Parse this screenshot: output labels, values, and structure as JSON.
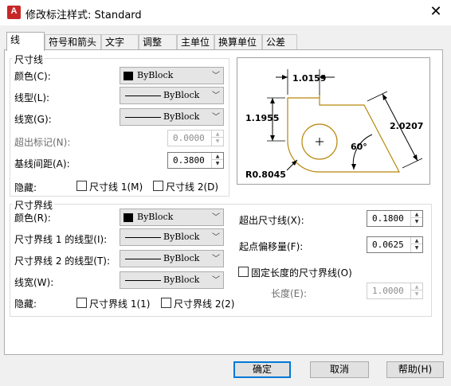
{
  "window": {
    "title": "修改标注样式: Standard",
    "icon_text": "A",
    "close_glyph": "✕"
  },
  "tabs": [
    {
      "label": "线"
    },
    {
      "label": "符号和箭头"
    },
    {
      "label": "文字"
    },
    {
      "label": "调整"
    },
    {
      "label": "主单位"
    },
    {
      "label": "换算单位"
    },
    {
      "label": "公差"
    }
  ],
  "dim_lines": {
    "group_title": "尺寸线",
    "color_label": "颜色(C):",
    "color_value": "ByBlock",
    "linetype_label": "线型(L):",
    "linetype_value": "ByBlock",
    "lineweight_label": "线宽(G):",
    "lineweight_value": "ByBlock",
    "extend_ticks_label": "超出标记(N):",
    "extend_ticks_value": "0.0000",
    "baseline_spacing_label": "基线间距(A):",
    "baseline_spacing_value": "0.3800",
    "suppress_label": "隐藏:",
    "suppress_1": "尺寸线 1(M)",
    "suppress_2": "尺寸线 2(D)"
  },
  "ext_lines": {
    "group_title": "尺寸界线",
    "color_label": "颜色(R):",
    "color_value": "ByBlock",
    "linetype1_label": "尺寸界线 1 的线型(I):",
    "linetype1_value": "ByBlock",
    "linetype2_label": "尺寸界线 2 的线型(T):",
    "linetype2_value": "ByBlock",
    "lineweight_label": "线宽(W):",
    "lineweight_value": "ByBlock",
    "suppress_label": "隐藏:",
    "suppress_1": "尺寸界线 1(1)",
    "suppress_2": "尺寸界线 2(2)",
    "extend_beyond_label": "超出尺寸线(X):",
    "extend_beyond_value": "0.1800",
    "offset_label": "起点偏移量(F):",
    "offset_value": "0.0625",
    "fixed_length_label": "固定长度的尺寸界线(O)",
    "length_label": "长度(E):",
    "length_value": "1.0000"
  },
  "preview": {
    "dim_top": "1.0159",
    "dim_left": "1.1955",
    "dim_right": "2.0207",
    "angle": "60°",
    "radius": "R0.8045"
  },
  "buttons": {
    "ok": "确定",
    "cancel": "取消",
    "help": "帮助(H)"
  },
  "colors": {
    "outline": "#b8860b",
    "accent": "#0078d7"
  }
}
